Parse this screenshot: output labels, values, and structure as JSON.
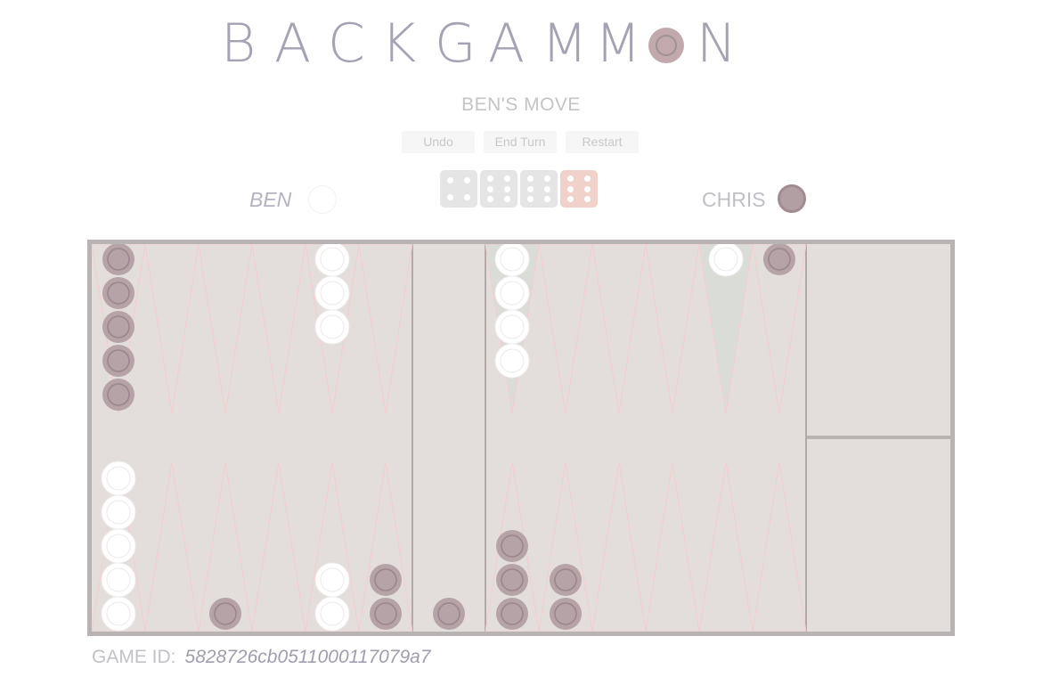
{
  "title": {
    "letters_before": [
      "B",
      "A",
      "C",
      "K",
      "G",
      "A",
      "M",
      "M"
    ],
    "letters_after": [
      "N"
    ]
  },
  "status": "BEN'S MOVE",
  "buttons": {
    "undo": "Undo",
    "end_turn": "End Turn",
    "restart": "Restart"
  },
  "players": {
    "left": "BEN",
    "right": "CHRIS"
  },
  "dice": [
    {
      "value": 4,
      "used": false
    },
    {
      "value": 6,
      "used": false
    },
    {
      "value": 6,
      "used": false
    },
    {
      "value": 6,
      "used": true
    }
  ],
  "game_id": {
    "label": "GAME ID:",
    "value": "5828726cb0511000117079a7"
  },
  "board": {
    "colors": {
      "frame": "#b7b4b3",
      "felt": "#e3dedb",
      "point_line": "#f3cdcf",
      "dark_checker": "#b29fa4",
      "white_checker": "#ffffff",
      "highlight": "#dadcd8"
    },
    "top_points": [
      {
        "dark": 5,
        "white": 0
      },
      {
        "dark": 0,
        "white": 0
      },
      {
        "dark": 0,
        "white": 0
      },
      {
        "dark": 0,
        "white": 0
      },
      {
        "dark": 0,
        "white": 3
      },
      {
        "dark": 0,
        "white": 0
      },
      {
        "dark": 0,
        "white": 4,
        "highlight": true
      },
      {
        "dark": 0,
        "white": 0
      },
      {
        "dark": 0,
        "white": 0
      },
      {
        "dark": 0,
        "white": 0
      },
      {
        "dark": 0,
        "white": 1,
        "highlight": true
      },
      {
        "dark": 1,
        "white": 0
      }
    ],
    "bottom_points": [
      {
        "dark": 0,
        "white": 5
      },
      {
        "dark": 0,
        "white": 0
      },
      {
        "dark": 1,
        "white": 0
      },
      {
        "dark": 0,
        "white": 0
      },
      {
        "dark": 0,
        "white": 2
      },
      {
        "dark": 2,
        "white": 0
      },
      {
        "dark": 3,
        "white": 0
      },
      {
        "dark": 2,
        "white": 0
      },
      {
        "dark": 0,
        "white": 0
      },
      {
        "dark": 0,
        "white": 0
      },
      {
        "dark": 0,
        "white": 0
      },
      {
        "dark": 0,
        "white": 0
      }
    ],
    "bar": {
      "dark": 1,
      "white": 0
    }
  }
}
